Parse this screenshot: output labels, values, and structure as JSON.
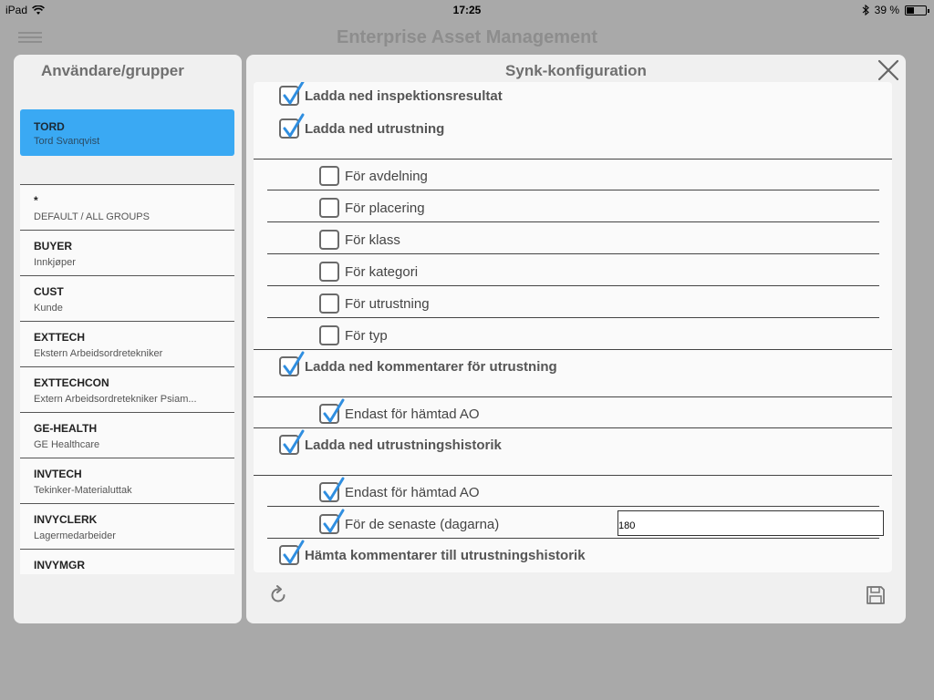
{
  "status": {
    "device": "iPad",
    "time": "17:25",
    "battery_text": "39 %",
    "battery_level": 0.39
  },
  "app": {
    "title": "Enterprise Asset Management"
  },
  "users_panel": {
    "title": "Användare/grupper",
    "selected": {
      "code": "TORD",
      "name": "Tord Svanqvist"
    },
    "groups": [
      {
        "code": "*",
        "desc": "DEFAULT / ALL GROUPS"
      },
      {
        "code": "BUYER",
        "desc": "Innkjøper"
      },
      {
        "code": "CUST",
        "desc": "Kunde"
      },
      {
        "code": "EXTTECH",
        "desc": "Ekstern Arbeidsordretekniker"
      },
      {
        "code": "EXTTECHCON",
        "desc": "Extern Arbeidsordretekniker Psiam..."
      },
      {
        "code": "GE-HEALTH",
        "desc": "GE Healthcare"
      },
      {
        "code": "INVTECH",
        "desc": "Tekinker-Materialuttak"
      },
      {
        "code": "INVYCLERK",
        "desc": "Lagermedarbeider"
      },
      {
        "code": "INVYMGR",
        "desc": ""
      }
    ]
  },
  "sync_panel": {
    "title": "Synk-konfiguration",
    "options": {
      "download_inspection_results": {
        "label": "Ladda ned inspektionsresultat",
        "checked": true
      },
      "download_equipment": {
        "label": "Ladda ned utrustning",
        "checked": true
      },
      "for_department": {
        "label": "För avdelning",
        "checked": false
      },
      "for_location": {
        "label": "För placering",
        "checked": false
      },
      "for_class": {
        "label": "För klass",
        "checked": false
      },
      "for_category": {
        "label": "För kategori",
        "checked": false
      },
      "for_equipment": {
        "label": "För utrustning",
        "checked": false
      },
      "for_type": {
        "label": "För typ",
        "checked": false
      },
      "download_equipment_comments": {
        "label": "Ladda ned kommentarer för utrustning",
        "checked": true
      },
      "comments_only_fetched_wo": {
        "label": "Endast för hämtad AO",
        "checked": true
      },
      "download_equipment_history": {
        "label": "Ladda ned utrustningshistorik",
        "checked": true
      },
      "history_only_fetched_wo": {
        "label": "Endast för hämtad AO",
        "checked": true
      },
      "for_last_days": {
        "label": "För de senaste (dagarna)",
        "checked": true
      },
      "fetch_history_comments": {
        "label": "Hämta kommentarer till utrustningshistorik",
        "checked": true
      }
    },
    "days_value": "180"
  }
}
